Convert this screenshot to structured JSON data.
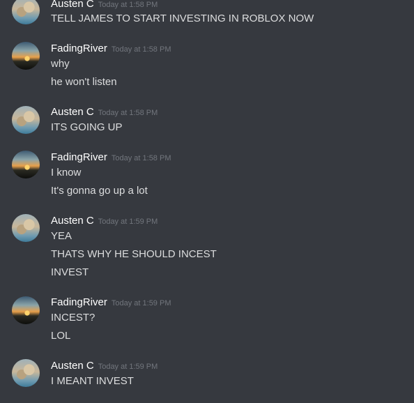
{
  "messages": [
    {
      "author": "Austen C",
      "timestamp": "Today at 1:58 PM",
      "avatar": "austen",
      "lines": [
        "TELL JAMES TO START INVESTING IN ROBLOX NOW"
      ]
    },
    {
      "author": "FadingRiver",
      "timestamp": "Today at 1:58 PM",
      "avatar": "fading",
      "lines": [
        "why",
        "he won't listen"
      ]
    },
    {
      "author": "Austen C",
      "timestamp": "Today at 1:58 PM",
      "avatar": "austen",
      "lines": [
        "ITS GOING UP"
      ]
    },
    {
      "author": "FadingRiver",
      "timestamp": "Today at 1:58 PM",
      "avatar": "fading",
      "lines": [
        "I know",
        "It's gonna go up a lot"
      ]
    },
    {
      "author": "Austen C",
      "timestamp": "Today at 1:59 PM",
      "avatar": "austen",
      "lines": [
        "YEA",
        "THATS WHY HE SHOULD INCEST",
        "INVEST"
      ]
    },
    {
      "author": "FadingRiver",
      "timestamp": "Today at 1:59 PM",
      "avatar": "fading",
      "lines": [
        "INCEST?",
        "LOL"
      ]
    },
    {
      "author": "Austen C",
      "timestamp": "Today at 1:59 PM",
      "avatar": "austen",
      "lines": [
        "I MEANT INVEST"
      ]
    }
  ],
  "colors": {
    "background": "#36393f",
    "username": "#ffffff",
    "text": "#dcddde",
    "timestamp": "#72767d"
  }
}
